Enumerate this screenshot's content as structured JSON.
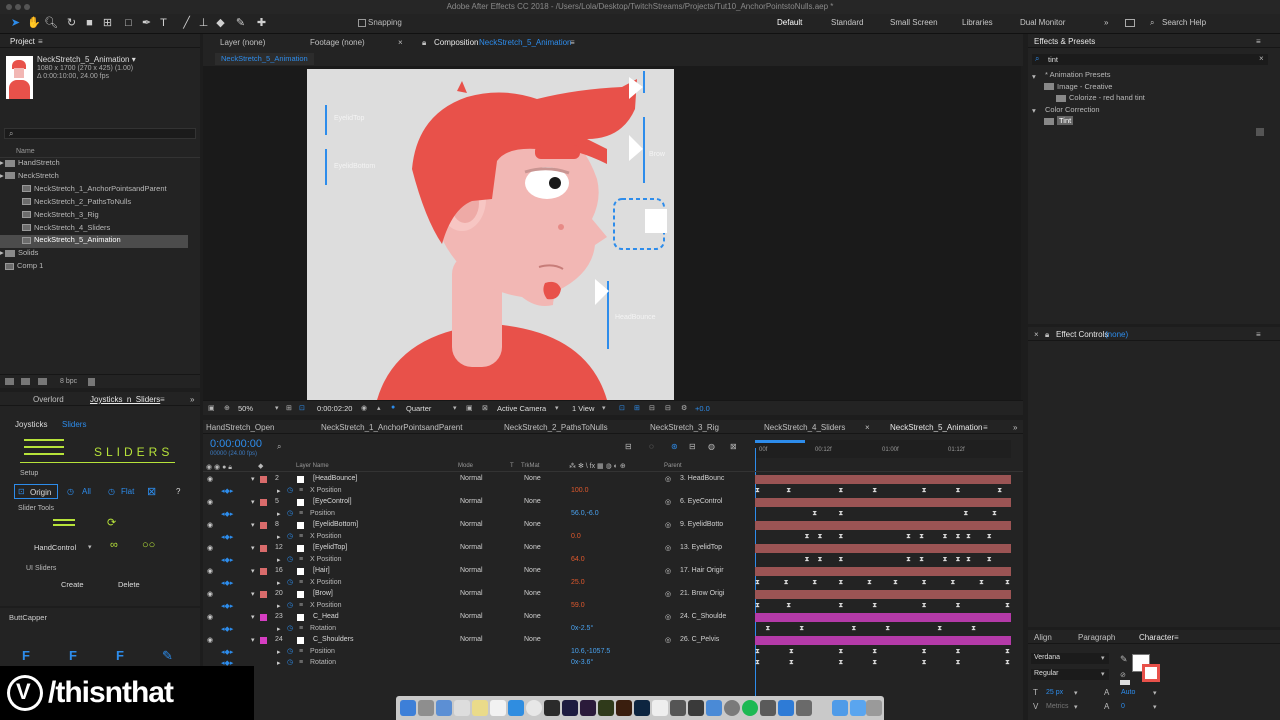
{
  "app": {
    "title": "Adobe After Effects CC 2018 - /Users/Lola/Desktop/TwitchStreams/Projects/Tut10_AnchorPointstoNulls.aep *"
  },
  "toolbar": {
    "snapping_label": "Snapping",
    "workspaces": [
      "Default",
      "Standard",
      "Small Screen",
      "Libraries",
      "Dual Monitor"
    ],
    "search_help": "Search Help"
  },
  "project": {
    "title": "Project",
    "comp_name": "NeckStretch_5_Animation ▾",
    "comp_dims": "1080 x 1700  (270 x 425) (1.00)",
    "comp_duration": "Δ 0:00:10:00, 24.00 fps",
    "search_placeholder": "",
    "col_name": "Name",
    "items": [
      {
        "label": "HandStretch",
        "type": "folder",
        "indent": 0
      },
      {
        "label": "NeckStretch",
        "type": "folder",
        "indent": 0
      },
      {
        "label": "NeckStretch_1_AnchorPointsandParent",
        "type": "comp",
        "indent": 1
      },
      {
        "label": "NeckStretch_2_PathsToNulls",
        "type": "comp",
        "indent": 1
      },
      {
        "label": "NeckStretch_3_Rig",
        "type": "comp",
        "indent": 1
      },
      {
        "label": "NeckStretch_4_Sliders",
        "type": "comp",
        "indent": 1
      },
      {
        "label": "NeckStretch_5_Animation",
        "type": "comp",
        "indent": 1,
        "selected": true
      },
      {
        "label": "Solids",
        "type": "folder",
        "indent": 0
      },
      {
        "label": "Comp 1",
        "type": "comp",
        "indent": 0
      }
    ],
    "bpc": "8 bpc"
  },
  "joysticks": {
    "tab_overlord": "Overlord",
    "tab_joysticks": "Joysticks_n_Sliders",
    "sub_joysticks": "Joysticks",
    "sub_sliders": "Sliders",
    "logo_text": "SLIDERS",
    "setup_label": "Setup",
    "origin_label": "Origin",
    "all_label": "All",
    "flat_label": "Flat",
    "help_label": "?",
    "slider_tools_label": "Slider Tools",
    "handcontrol_label": "HandControl",
    "ui_sliders_label": "UI Sliders",
    "create_label": "Create",
    "delete_label": "Delete",
    "buttcapper_label": "ButtCapper"
  },
  "viewer_tabs": {
    "layer": "Layer (none)",
    "footage": "Footage (none)",
    "composition_prefix": "Composition",
    "composition_name": "NeckStretch_5_Animation",
    "breadcrumb": "NeckStretch_5_Animation"
  },
  "canvas_labels": {
    "eyelid_top": "EyelidTop",
    "eyelid_bottom": "EyelidBottom",
    "brow": "Brow",
    "head_bounce": "HeadBounce"
  },
  "viewer_controls": {
    "zoom": "50%",
    "timecode": "0:00:02:20",
    "resolution": "Quarter",
    "camera": "Active Camera",
    "views": "1 View",
    "exposure": "+0.0"
  },
  "timeline": {
    "tabs": [
      "HandStretch_Open",
      "NeckStretch_1_AnchorPointsandParent",
      "NeckStretch_2_PathsToNulls",
      "NeckStretch_3_Rig",
      "NeckStretch_4_Sliders",
      "NeckStretch_5_Animation"
    ],
    "timecode": "0:00:00:00",
    "timecode_sub": "00000 (24.00 fps)",
    "col_layer_name": "Layer Name",
    "col_mode": "Mode",
    "col_t": "T",
    "col_trkmat": "TrkMat",
    "col_parent": "Parent",
    "ruler": [
      "00f",
      "00:12f",
      "01:00f",
      "01:12f"
    ],
    "rows": [
      {
        "kind": "layer",
        "num": "2",
        "name": "[HeadBounce]",
        "color": "#d96b6b",
        "mode": "Normal",
        "trk": "None",
        "parent": "3. HeadBounc",
        "bar": "#9b5454"
      },
      {
        "kind": "prop",
        "name": "X Position",
        "value": "100.0",
        "vcolor": "o",
        "keys": [
          0,
          12,
          32,
          45,
          64,
          77,
          93
        ]
      },
      {
        "kind": "layer",
        "num": "5",
        "name": "[EyeControl]",
        "color": "#d96b6b",
        "mode": "Normal",
        "trk": "None",
        "parent": "6. EyeControl",
        "bar": "#9b5454"
      },
      {
        "kind": "prop",
        "name": "Position",
        "value": "56.0,-6.0",
        "vcolor": "b",
        "keys": [
          22,
          32,
          80,
          91
        ]
      },
      {
        "kind": "layer",
        "num": "8",
        "name": "[EyelidBottom]",
        "color": "#d96b6b",
        "mode": "Normal",
        "trk": "None",
        "parent": "9. EyelidBotto",
        "bar": "#9b5454"
      },
      {
        "kind": "prop",
        "name": "X Position",
        "value": "0.0",
        "vcolor": "o",
        "keys": [
          19,
          24,
          32,
          58,
          63,
          72,
          77,
          81,
          89
        ]
      },
      {
        "kind": "layer",
        "num": "12",
        "name": "[EyelidTop]",
        "color": "#d96b6b",
        "mode": "Normal",
        "trk": "None",
        "parent": "13. EyelidTop",
        "bar": "#9b5454"
      },
      {
        "kind": "prop",
        "name": "X Position",
        "value": "64.0",
        "vcolor": "o",
        "keys": [
          19,
          24,
          32,
          58,
          63,
          72,
          77,
          81,
          89
        ]
      },
      {
        "kind": "layer",
        "num": "16",
        "name": "[Hair]",
        "color": "#d96b6b",
        "mode": "Normal",
        "trk": "None",
        "parent": "17. Hair Origir",
        "bar": "#9b5454"
      },
      {
        "kind": "prop",
        "name": "X Position",
        "value": "25.0",
        "vcolor": "o",
        "keys": [
          0,
          11,
          22,
          32,
          43,
          53,
          64,
          75,
          86,
          96
        ]
      },
      {
        "kind": "layer",
        "num": "20",
        "name": "[Brow]",
        "color": "#d96b6b",
        "mode": "Normal",
        "trk": "None",
        "parent": "21. Brow Origi",
        "bar": "#9b5454"
      },
      {
        "kind": "prop",
        "name": "X Position",
        "value": "59.0",
        "vcolor": "o",
        "keys": [
          0,
          12,
          32,
          45,
          64,
          77,
          96
        ]
      },
      {
        "kind": "layer",
        "num": "23",
        "name": "C_Head",
        "color": "#d63ec2",
        "mode": "Normal",
        "trk": "None",
        "parent": "24. C_Shoulde",
        "bar": "#b43aa8"
      },
      {
        "kind": "prop",
        "name": "Rotation",
        "value": "0x-2.5°",
        "vcolor": "b",
        "keys": [
          4,
          17,
          37,
          50,
          70,
          83
        ]
      },
      {
        "kind": "layer",
        "num": "24",
        "name": "C_Shoulders",
        "color": "#d63ec2",
        "mode": "Normal",
        "trk": "None",
        "parent": "26. C_Pelvis",
        "bar": "#b43aa8"
      },
      {
        "kind": "prop",
        "name": "Position",
        "value": "10.6,-1057.5",
        "vcolor": "b",
        "keys": [
          0,
          13,
          32,
          45,
          64,
          77,
          96
        ]
      },
      {
        "kind": "prop",
        "name": "Rotation",
        "value": "0x-3.6°",
        "vcolor": "b",
        "keys": [
          0,
          13,
          32,
          45,
          64,
          77,
          96
        ]
      }
    ]
  },
  "effects": {
    "title": "Effects & Presets",
    "search_value": "tint",
    "tree": [
      {
        "label": "* Animation Presets",
        "indent": 0
      },
      {
        "label": "Image - Creative",
        "indent": 1
      },
      {
        "label": "Colorize - red hand tint",
        "indent": 2
      },
      {
        "label": "Color Correction",
        "indent": 0
      },
      {
        "label": "Tint",
        "indent": 1,
        "highlight": true
      }
    ]
  },
  "effect_controls": {
    "prefix": "Effect Controls",
    "value": "(none)"
  },
  "character": {
    "tab_align": "Align",
    "tab_paragraph": "Paragraph",
    "tab_character": "Character",
    "font": "Verdana",
    "style": "Regular",
    "size": "25 px",
    "leading": "Auto",
    "metrics": "Metrics",
    "tracking": "0"
  },
  "watermark": {
    "text": "/thisnthat"
  },
  "colors": {
    "accent": "#2d8ceb",
    "value_orange": "#e0592d",
    "hair_red": "#e8514a",
    "skin": "#f2b7b4",
    "canvas_bg": "#dddddd"
  }
}
